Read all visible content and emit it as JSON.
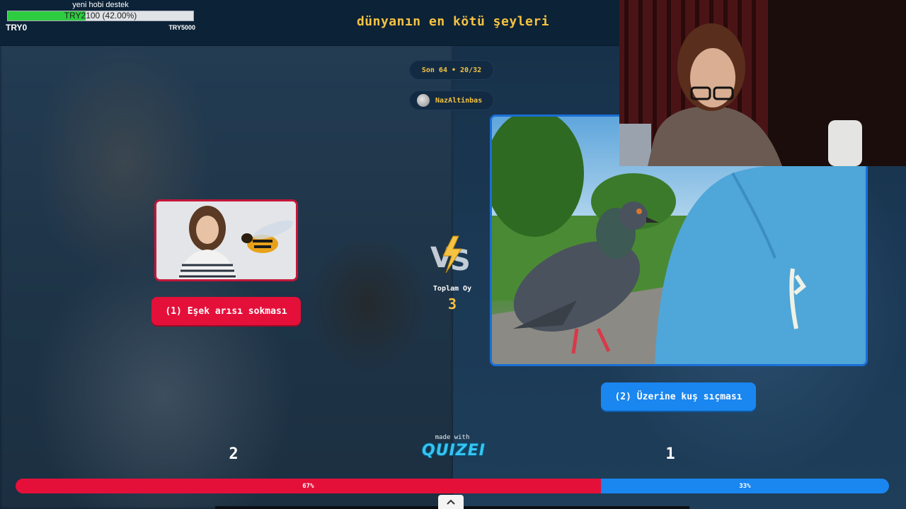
{
  "quiz": {
    "title": "dünyanın en kötü şeyleri"
  },
  "donation": {
    "title": "yeni hobi destek",
    "progress_text": "TRY2100 (42.00%)",
    "progress_fraction": 0.42,
    "min": "TRY0",
    "max": "TRY5000"
  },
  "round": {
    "label": "Son 64 • 20/32"
  },
  "user": {
    "name": "NazAltinbas"
  },
  "vs": {
    "total_label": "Toplam Oy",
    "total_value": "3"
  },
  "options": [
    {
      "label": "(1) Eşek arısı sokması",
      "votes": "2",
      "percent": "67%",
      "fraction": 0.67,
      "color": "#e4103a"
    },
    {
      "label": "(2) Üzerine kuş sıçması",
      "votes": "1",
      "percent": "33%",
      "fraction": 0.33,
      "color": "#1a86f0"
    }
  ],
  "branding": {
    "made_with": "made with",
    "logo": "QUIZEI"
  },
  "icons": {
    "vs": "vs-lightning-icon",
    "user": "user-avatar-icon",
    "scroll": "chevron-up-icon"
  }
}
